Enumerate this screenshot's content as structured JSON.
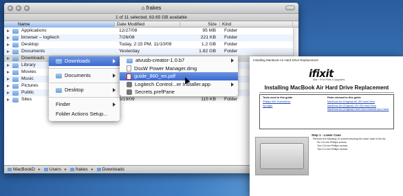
{
  "window": {
    "title": "frakes",
    "status": "1 of 11 selected, 63.65 GB available"
  },
  "columns": {
    "name": "Name",
    "date": "Date Modified",
    "size": "Size",
    "kind": "Kind"
  },
  "rows": [
    {
      "name": "Applications",
      "date": "12/27/08",
      "size": "95 MB",
      "kind": "Folder"
    },
    {
      "name": "browser – logitech",
      "date": "7/26/08",
      "size": "221 KB",
      "kind": "Folder"
    },
    {
      "name": "Desktop",
      "date": "Today, 2:15 PM, 11/10/09",
      "size": "1.2 GB",
      "kind": "Folder"
    },
    {
      "name": "Documents",
      "date": "Yesterday",
      "size": "1.82 GB",
      "kind": "Folder"
    },
    {
      "name": "Downloads",
      "date": "",
      "size": "",
      "kind": ""
    },
    {
      "name": "Library",
      "date": "",
      "size": "",
      "kind": ""
    },
    {
      "name": "Movies",
      "date": "",
      "size": "",
      "kind": ""
    },
    {
      "name": "Music",
      "date": "",
      "size": "",
      "kind": ""
    },
    {
      "name": "Pictures",
      "date": "",
      "size": "",
      "kind": ""
    },
    {
      "name": "Public",
      "date": "",
      "size": "",
      "kind": ""
    },
    {
      "name": "Sites",
      "date": "5/19/09",
      "size": "115 KB",
      "kind": "Folder"
    }
  ],
  "pathbar": [
    "MacBookD",
    "Users",
    "frakes",
    "Downloads"
  ],
  "menu1": [
    "Downloads",
    "Documents",
    "Desktop",
    "Finder",
    "Folder Actions Setup..."
  ],
  "menu2": [
    "atvusb-creator-1.0.b7",
    "DssW Power Manager.dmg",
    "guide_860_en.pdf",
    "Logitech Control...er Installer.app",
    "Secrets.prefPane"
  ],
  "preview": {
    "header": "Installing MacBook Air Hard Drive Replacement",
    "logo_text": "ifixit",
    "logo_sub": "Mac + iPod Parts & Upgrades",
    "title": "Installing MacBook Air Hard Drive Replacement",
    "tools_head": "Tools used in this guide",
    "tools": [
      "Phillips #00 Screwdriver",
      "Spudger"
    ],
    "parts_head": "Parts relevant to this guide",
    "parts": [
      "MacBook Air (Original) 80 GB Hard Drive",
      "MacBook Air (Original) 120 GB Hard Drive",
      "MacBook Air (Original) Hard Drive Bracket and Cable"
    ],
    "step_title": "Step 1 - Lower Case",
    "step_text": [
      "Remove the following 10 screws securing the lower case to the Air:",
      "Six 2.6 mm Phillips screws.",
      "Two 2.8 mm Phillips screws.",
      "Two 3.4 mm Phillips screws."
    ]
  }
}
